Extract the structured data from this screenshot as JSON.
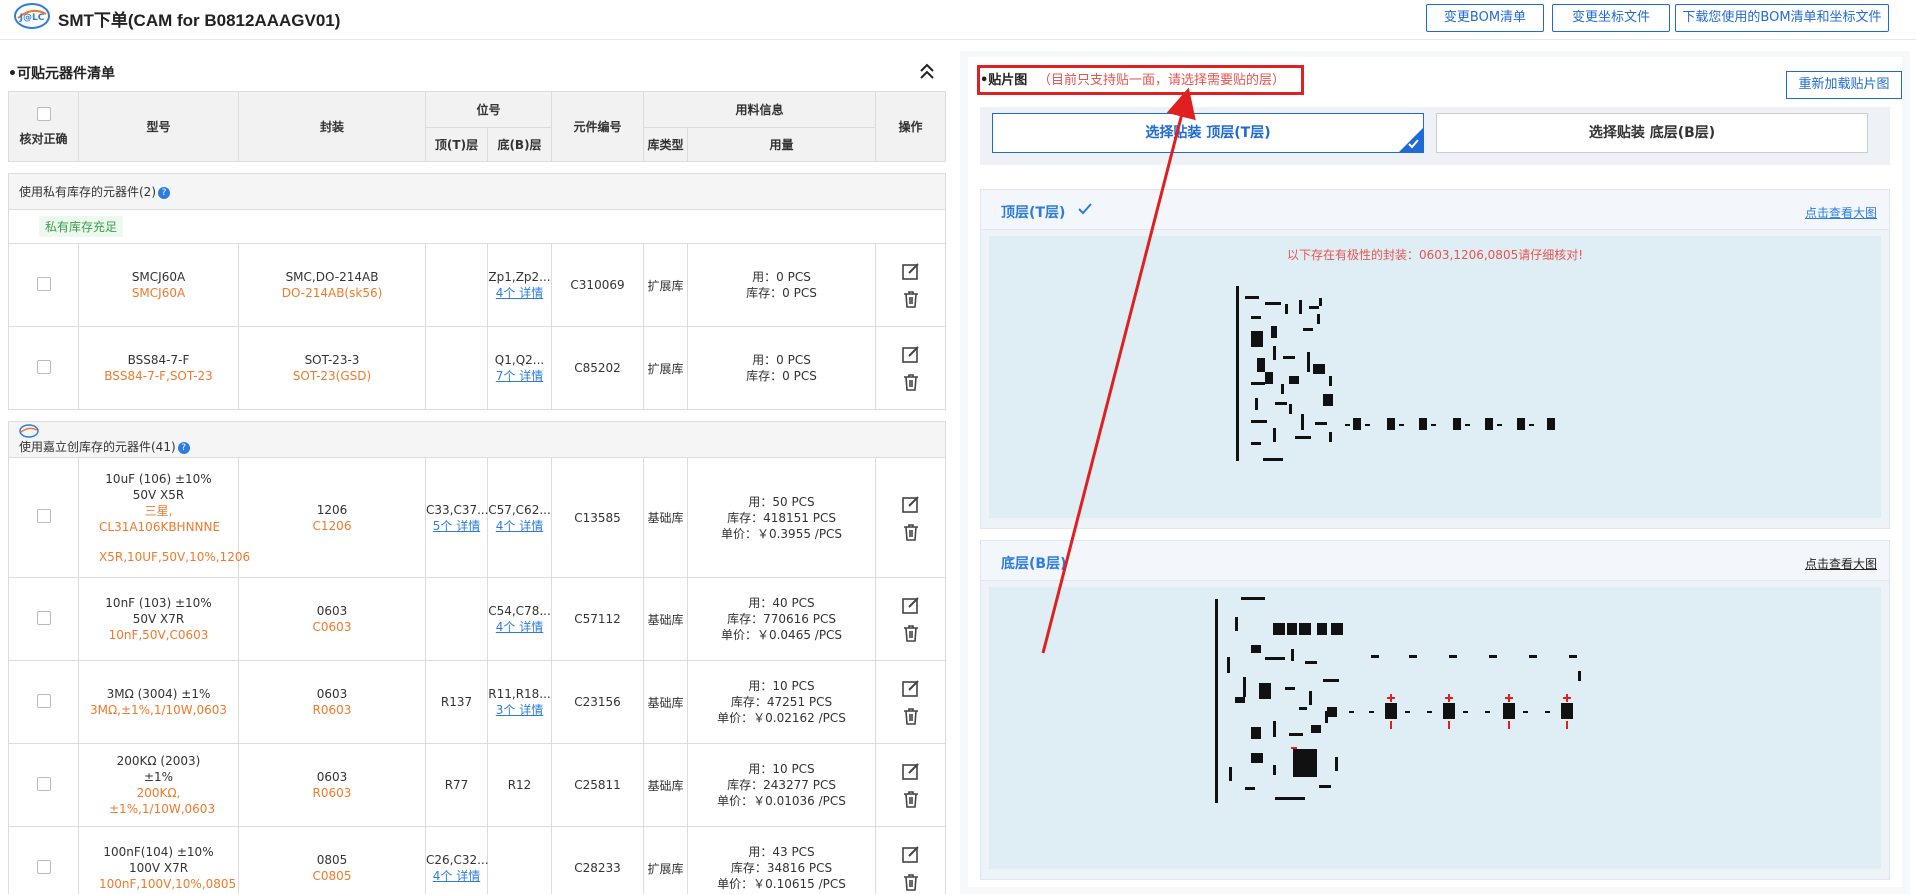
{
  "header": {
    "title": "SMT下单(CAM for B0812AAAGV01)",
    "buttons": [
      "变更BOM清单",
      "变更坐标文件",
      "下载您使用的BOM清单和坐标文件"
    ]
  },
  "left": {
    "section_title": "•可贴元器件清单",
    "table_headers": {
      "check": "核对正确",
      "model": "型号",
      "package": "封装",
      "position": "位号",
      "top": "顶(T)层",
      "bottom": "底(B)层",
      "part_no": "元件编号",
      "material": "用料信息",
      "lib_type": "库类型",
      "usage": "用量",
      "ops": "操作"
    },
    "group_private": "使用私有库存的元器件(2)",
    "group_private_tag": "私有库存充足",
    "group_jlc": "使用嘉立创库存的元器件(41)",
    "private_rows": [
      {
        "model": "SMCJ60A",
        "model_sub": "SMCJ60A",
        "package": "SMC,DO-214AB",
        "package_sub": "DO-214AB(sk56)",
        "top": "",
        "top_link": "",
        "bottom": "Zp1,Zp2...",
        "bottom_link": "4个 详情",
        "part_no": "C310069",
        "lib": "扩展库",
        "usage1": "用：0 PCS",
        "usage2": "库存：0 PCS",
        "usage3": ""
      },
      {
        "model": "BSS84-7-F",
        "model_sub": "BSS84-7-F,SOT-23",
        "package": "SOT-23-3",
        "package_sub": "SOT-23(GSD)",
        "top": "",
        "top_link": "",
        "bottom": "Q1,Q2...",
        "bottom_link": "7个 详情",
        "part_no": "C85202",
        "lib": "扩展库",
        "usage1": "用：0 PCS",
        "usage2": "库存：0 PCS",
        "usage3": ""
      }
    ],
    "jlc_rows": [
      {
        "model": "10uF (106) ±10% 50V X5R",
        "model_sub": "三星, CL31A106KBHNNNE",
        "model_sub2": "X5R,10UF,50V,10%,1206",
        "package": "1206",
        "package_sub": "C1206",
        "top": "C33,C37...",
        "top_link": "5个 详情",
        "bottom": "C57,C62...",
        "bottom_link": "4个 详情",
        "part_no": "C13585",
        "lib": "基础库",
        "usage1": "用：50 PCS",
        "usage2": "库存：418151 PCS",
        "usage3": "单价：￥0.3955 /PCS"
      },
      {
        "model": "10nF (103) ±10% 50V X7R",
        "model_sub": "10nF,50V,C0603",
        "model_sub2": "",
        "package": "0603",
        "package_sub": "C0603",
        "top": "",
        "top_link": "",
        "bottom": "C54,C78...",
        "bottom_link": "4个 详情",
        "part_no": "C57112",
        "lib": "基础库",
        "usage1": "用：40 PCS",
        "usage2": "库存：770616 PCS",
        "usage3": "单价：￥0.0465 /PCS"
      },
      {
        "model": "3MΩ (3004) ±1%",
        "model_sub": "3MΩ,±1%,1/10W,0603",
        "model_sub2": "",
        "package": "0603",
        "package_sub": "R0603",
        "top": "R137",
        "top_link": "",
        "bottom": "R11,R18...",
        "bottom_link": "3个 详情",
        "part_no": "C23156",
        "lib": "基础库",
        "usage1": "用：10 PCS",
        "usage2": "库存：47251 PCS",
        "usage3": "单价：￥0.02162 /PCS"
      },
      {
        "model": "200KΩ (2003) ±1%",
        "model_sub": "200KΩ, ±1%,1/10W,0603",
        "model_sub2": "",
        "package": "0603",
        "package_sub": "R0603",
        "top": "R77",
        "top_link": "",
        "bottom": "R12",
        "bottom_link": "",
        "part_no": "C25811",
        "lib": "基础库",
        "usage1": "用：10 PCS",
        "usage2": "库存：243277 PCS",
        "usage3": "单价：￥0.01036 /PCS"
      },
      {
        "model": "100nF(104) ±10% 100V X7R",
        "model_sub": "100nF,100V,10%,0805",
        "model_sub2": "",
        "package": "0805",
        "package_sub": "C0805",
        "top": "C26,C32...",
        "top_link": "4个 详情",
        "bottom": "",
        "bottom_link": "",
        "part_no": "C28233",
        "lib": "扩展库",
        "usage1": "用：43 PCS",
        "usage2": "库存：34816 PCS",
        "usage3": "单价：￥0.10615 /PCS"
      }
    ]
  },
  "right": {
    "title": "•贴片图",
    "note": "（目前只支持贴一面，请选择需要贴的层）",
    "reload": "重新加载贴片图",
    "select_top": "选择贴装 顶层(T层)",
    "select_bottom": "选择贴装 底层(B层)",
    "top_card_title": "顶层(T层)",
    "top_card_link": "点击查看大图",
    "top_warning": "以下存在有极性的封装：0603,1206,0805请仔细核对!",
    "bottom_card_title": "底层(B层)",
    "bottom_card_link": "点击查看大图"
  },
  "colors": {
    "accent": "#1e6ad6",
    "orange": "#f07a2a",
    "warning": "#e8544f",
    "annotation": "#e02020"
  }
}
